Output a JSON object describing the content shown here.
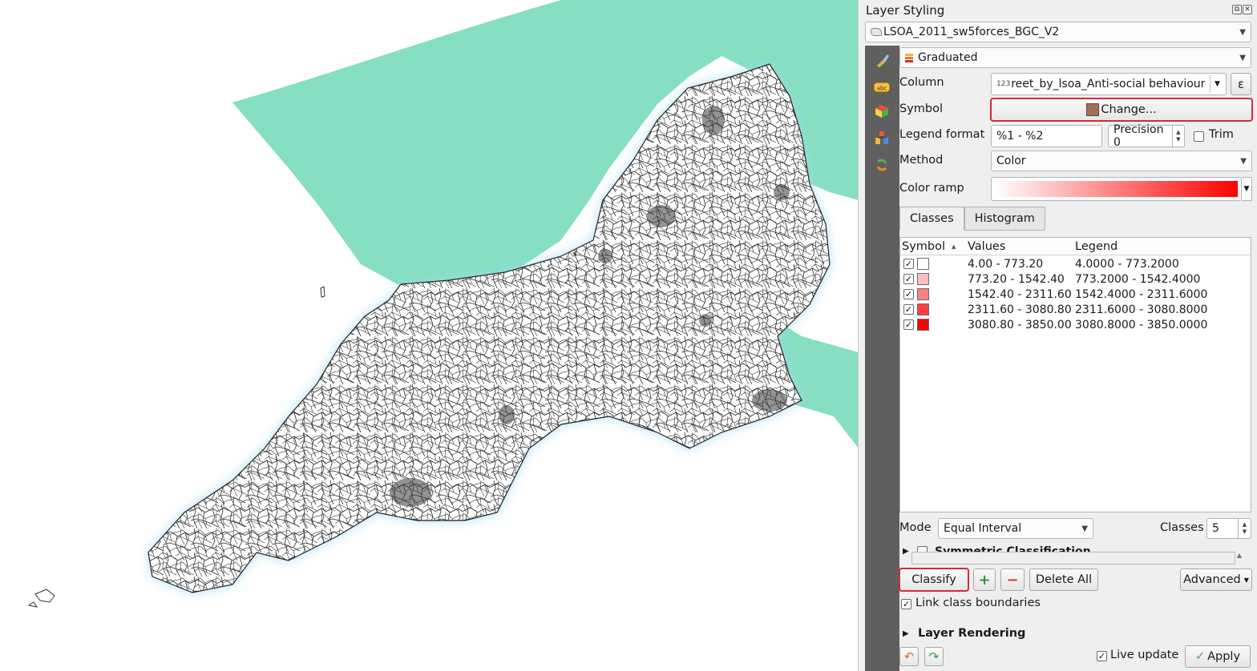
{
  "panel": {
    "title": "Layer Styling",
    "layer_name": "LSOA_2011_sw5forces_BGC_V2",
    "renderer": "Graduated",
    "column_label": "Column",
    "column_prefix": "123",
    "column_value": "reet_by_lsoa_Anti-social behaviour",
    "expression_glyph": "ε",
    "symbol_label": "Symbol",
    "symbol_button": "Change...",
    "symbol_color": "#a0705a",
    "legend_format_label": "Legend format",
    "legend_format_value": "%1 - %2",
    "precision_label": "Precision 0",
    "trim_label": "Trim",
    "method_label": "Method",
    "method_value": "Color",
    "color_ramp_label": "Color ramp",
    "color_ramp": {
      "start": "#ffffff",
      "end": "#ff0000"
    }
  },
  "tabs": [
    "Classes",
    "Histogram"
  ],
  "table": {
    "headers": [
      "Symbol",
      "Values",
      "Legend"
    ],
    "sort_indicator": "▲",
    "rows": [
      {
        "checked": true,
        "color": "#ffffff",
        "values": "4.00 - 773.20",
        "legend": "4.0000 - 773.2000"
      },
      {
        "checked": true,
        "color": "#ffbfbf",
        "values": "773.20 - 1542.40",
        "legend": "773.2000 - 1542.4000"
      },
      {
        "checked": true,
        "color": "#ff8080",
        "values": "1542.40 - 2311.60",
        "legend": "1542.4000 - 2311.6000"
      },
      {
        "checked": true,
        "color": "#ff4040",
        "values": "2311.60 - 3080.80",
        "legend": "2311.6000 - 3080.8000"
      },
      {
        "checked": true,
        "color": "#ff0000",
        "values": "3080.80 - 3850.00",
        "legend": "3080.8000 - 3850.0000"
      }
    ]
  },
  "mode": {
    "label": "Mode",
    "value": "Equal Interval",
    "classes_label": "Classes",
    "classes_value": "5"
  },
  "symmetric_label": "Symmetric Classification",
  "buttons": {
    "classify": "Classify",
    "add": "+",
    "remove": "−",
    "delete_all": "Delete All",
    "advanced": "Advanced"
  },
  "link_boundaries_label": "Link class boundaries",
  "layer_rendering_label": "Layer Rendering",
  "live_update_label": "Live update",
  "apply_label": "Apply",
  "colors": {
    "sea": "#86dfc2",
    "highlight": "#d32a3a"
  }
}
